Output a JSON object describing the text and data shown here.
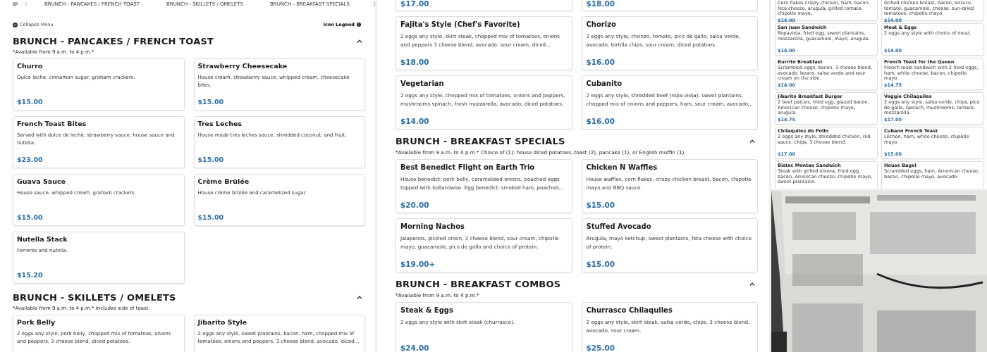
{
  "left_panel": {
    "nav_tabs": [
      "BRUNCH - PANCAKES / FRENCH TOAST",
      "BRUNCH - SKILLETS / OMELETS",
      "BRUNCH - BREAKFAST SPECIALS"
    ],
    "collapse_label": "Collapse Menu",
    "legend_label": "Icon Legend",
    "sections": [
      {
        "title": "BRUNCH - PANCAKES / FRENCH TOAST",
        "note": "*Available from 9 a.m. to 4 p.m.*",
        "items": [
          {
            "name": "Churro",
            "description": "Dulce leche, cinnamon sugar, graham crackers.",
            "price": "$15.00"
          },
          {
            "name": "Strawberry Cheesecake",
            "description": "House cream, strawberry sauce, whipped cream, cheesecake bites.",
            "price": "$15.00"
          },
          {
            "name": "French Toast Bites",
            "description": "Served with dulce de leche, strawberry sauce, house sauce and nutella.",
            "price": "$23.00"
          },
          {
            "name": "Tres Leches",
            "description": "House made tres leches sauce, shredded coconut, and fruit.",
            "price": "$15.00"
          },
          {
            "name": "Guava Sauce",
            "description": "House sauce, whipped cream, graham crackers.",
            "price": "$15.00"
          },
          {
            "name": "Crème Brûlée",
            "description": "House crème brûlée and caramelized sugar.",
            "price": "$15.00"
          },
          {
            "name": "Nutella Stack",
            "description": "Ferreros and nutella.",
            "price": "$15.20"
          }
        ]
      },
      {
        "title": "BRUNCH - SKILLETS / OMELETS",
        "note": "*Available from 9 a.m. to 4 p.m.* Includes side of toast.",
        "items": [
          {
            "name": "Pork Belly",
            "description": "2 eggs any style, pork belly, chopped mix of tomatoes, onions and peppers, 3 cheese blend, diced potatoes."
          },
          {
            "name": "Jibarito Style",
            "description": "2 eggs any style, sweet plantains, bacon, ham, chopped mix of tomatoes, onions and peppers, 3 cheese blend, avocado, diced..."
          }
        ]
      }
    ]
  },
  "middle_panel": {
    "sections": [
      {
        "items": [
          {
            "price": "$17.00"
          },
          {
            "price": "$18.00"
          },
          {
            "name": "Fajita's Style (Chef's Favorite)",
            "description": "2 eggs any style, skirt steak, chopped mix of tomatoes, onions and peppers 3 cheese blend, avocado, sour cream, diced...",
            "price": "$18.00"
          },
          {
            "name": "Chorizo",
            "description": "2 eggs any style, chorizo, tomato, pico de gallo, salsa verde, avocado, tortilla chips, sour cream, diced potatoes.",
            "price": "$16.00"
          },
          {
            "name": "Vegetarian",
            "description": "2 eggs any style, chopped mix of tomatoes, onions and peppers, mushrooms spinach, fresh mozzarella, avocado, diced potatoes.",
            "price": "$14.00"
          },
          {
            "name": "Cubanito",
            "description": "2 eggs any style, shredded beef (ropa vieja), sweet plantains, chopped mix of onions and peppers, ham, sour cream, avocado...",
            "price": "$16.00"
          }
        ]
      },
      {
        "title": "BRUNCH - BREAKFAST SPECIALS",
        "note": "*Available from 9 a.m. to 4 p.m.* Choice of (1): house diced potatoes, toast (2), pancake (1), or English muffin (1).",
        "items": [
          {
            "name": "Best Benedict Flight on Earth Trio",
            "description": "House benedict: pork belly, caramelized onions, poached eggs topped with hollandaise. Egg benedict: smoked ham, poached...",
            "price": "$20.00"
          },
          {
            "name": "Chicken N Waffles",
            "description": "House waffles, corn flakes, crispy chicken breast, bacon, chipotle mayo and BBQ sauce.",
            "price": "$15.00"
          },
          {
            "name": "Morning Nachos",
            "description": "Jalapenos, pickled onion, 3 cheese blend, sour cream, chipotle mayo, guacamole, pico de gallo and choice of protein.",
            "price": "$19.00+"
          },
          {
            "name": "Stuffed Avocado",
            "description": "Arugula, mayo ketchup, sweet plantains, feta cheese with choice of protein.",
            "price": "$15.00"
          }
        ]
      },
      {
        "title": "BRUNCH - BREAKFAST COMBOS",
        "note": "*Available from 9 a.m. to 4 p.m.*",
        "items": [
          {
            "name": "Steak & Eggs",
            "description": "2 eggs any style with skirt steak (churrasco).",
            "price": "$24.00"
          },
          {
            "name": "Churrasco Chilaquiles",
            "description": "2 eggs any style, skirt steak, salsa verde, chips, 3 cheese blend, avocado, sour cream.",
            "price": "$25.00"
          }
        ]
      }
    ]
  },
  "right_panel": {
    "items": [
      {
        "description": "Corn flakes crispy chicken, ham, bacon, feta cheese, arugula, grilled tomato, chipotle mayo.",
        "price": "$14.00"
      },
      {
        "description": "Grilled chicken breast, bacon, lettuce, tomato, guacamole, cheese, sun-dried tomatoes, chipotle mayo.",
        "price": "$14.00"
      },
      {
        "name": "San Juan Sandwich",
        "description": "Ropavieja, fried egg, sweet plantains, mozzarella, guacamole, mayo, arugula.",
        "price": "$14.00"
      },
      {
        "name": "Meat & Eggs",
        "description": "2 eggs any style with choice of meat.",
        "price": "$14.00"
      },
      {
        "name": "Burrito Breakfast",
        "description": "Scrambled eggs, bacon, 3 cheese blend, avocado, beans, salsa verde and sour cream on the side.",
        "price": "$14.00"
      },
      {
        "name": "French Toast for the Queen",
        "description": "French toast sandwich with 2 fried eggs, ham, white cheese, bacon, chipotle mayo.",
        "price": "$14.75"
      },
      {
        "name": "Jibarito Breakfast Burger",
        "description": "2 beef patties, fried egg, glazed bacon, American cheese, chipotle mayo, arugula.",
        "price": "$14.75"
      },
      {
        "name": "Veggie Chilaquiles",
        "description": "2 eggs any style, salsa verde, chips, pico de gallo, spinach, mushrooms, tomato, mozzarella.",
        "price": "$17.00"
      },
      {
        "name": "Chilaquiles de Pollo",
        "description": "2 eggs any style, shredded chicken, red sauce, chips, 3 cheese blend.",
        "price": "$17.00"
      },
      {
        "name": "Cubano French Toast",
        "description": "Lechon, ham, white cheese, chipotle mayo.",
        "price": "$15.00"
      },
      {
        "name": "Bistec Montao Sandwich",
        "description": "Steak with grilled onions, fried egg, bacon, American cheese, chipotle mayo, sweet plantains."
      },
      {
        "name": "House Bagel",
        "description": "Scrambled eggs, ham, American cheese, bacon, chipotle mayo, avocado."
      }
    ]
  }
}
